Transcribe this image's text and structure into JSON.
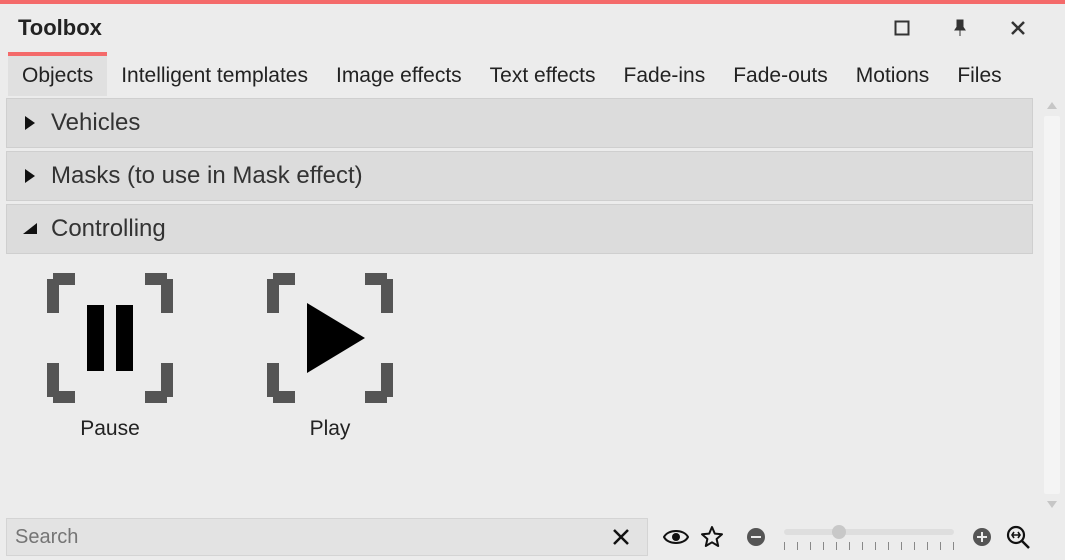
{
  "window": {
    "title": "Toolbox"
  },
  "tabs": [
    {
      "label": "Objects",
      "active": true
    },
    {
      "label": "Intelligent templates",
      "active": false
    },
    {
      "label": "Image effects",
      "active": false
    },
    {
      "label": "Text effects",
      "active": false
    },
    {
      "label": "Fade-ins",
      "active": false
    },
    {
      "label": "Fade-outs",
      "active": false
    },
    {
      "label": "Motions",
      "active": false
    },
    {
      "label": "Files",
      "active": false
    }
  ],
  "categories": [
    {
      "label": "Vehicles",
      "expanded": false
    },
    {
      "label": "Masks (to use in Mask effect)",
      "expanded": false
    },
    {
      "label": "Controlling",
      "expanded": true
    }
  ],
  "objects": [
    {
      "label": "Pause",
      "icon": "pause"
    },
    {
      "label": "Play",
      "icon": "play"
    }
  ],
  "search": {
    "placeholder": "Search"
  },
  "colors": {
    "accent": "#f46a6a"
  }
}
